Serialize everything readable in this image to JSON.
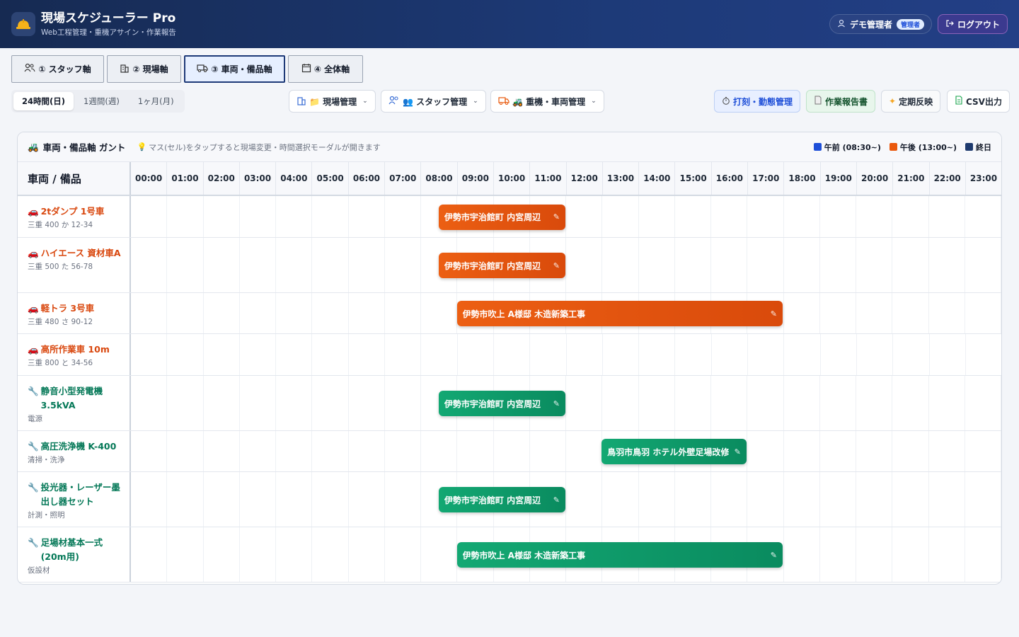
{
  "header": {
    "app_title": "現場スケジューラー Pro",
    "app_subtitle": "Web工程管理・重機アサイン・作業報告",
    "user_name": "デモ管理者",
    "role_badge": "管理者",
    "logout_label": "ログアウト"
  },
  "axis_tabs": [
    {
      "label": "① スタッフ軸",
      "icon": "people-icon",
      "active": false
    },
    {
      "label": "② 現場軸",
      "icon": "building-icon",
      "active": false
    },
    {
      "label": "③ 車両・備品軸",
      "icon": "truck-icon",
      "active": true
    },
    {
      "label": "④ 全体軸",
      "icon": "calendar-icon",
      "active": false
    }
  ],
  "range": [
    {
      "label": "24時間(日)",
      "active": true
    },
    {
      "label": "1週間(週)",
      "active": false
    },
    {
      "label": "1ヶ月(月)",
      "active": false
    }
  ],
  "menus": {
    "site": "📁 現場管理",
    "staff": "👥 スタッフ管理",
    "vehicle": "🚜 重機・車両管理"
  },
  "actions": {
    "punch": "打刻・勤態管理",
    "report": "作業報告書",
    "periodic": "定期反映",
    "csv": "CSV出力"
  },
  "gantt": {
    "title": "車両・備品軸 ガント",
    "hint": "マス(セル)をタップすると現場変更・時間選択モーダルが開きます",
    "legend": [
      {
        "label": "午前 (08:30~)",
        "color": "#1d4ed8"
      },
      {
        "label": "午後 (13:00~)",
        "color": "#ea580c"
      },
      {
        "label": "終日",
        "color": "#1e3a6e"
      }
    ],
    "resource_header": "車両 / 備品",
    "hours": [
      "00:00",
      "01:00",
      "02:00",
      "03:00",
      "04:00",
      "05:00",
      "06:00",
      "07:00",
      "08:00",
      "09:00",
      "10:00",
      "11:00",
      "12:00",
      "13:00",
      "14:00",
      "15:00",
      "16:00",
      "17:00",
      "18:00",
      "19:00",
      "20:00",
      "21:00",
      "22:00",
      "23:00"
    ],
    "rows": [
      {
        "name": "2tダンプ 1号車",
        "sub": "三重 400 か 12-34",
        "kind": "vehicle",
        "bar": {
          "label": "伊勢市宇治館町 内宮周辺",
          "start": 8.5,
          "end": 12.0,
          "color": "orange"
        }
      },
      {
        "name": "ハイエース 資材車A",
        "sub": "三重 500 た 56-78",
        "kind": "vehicle",
        "bar": {
          "label": "伊勢市宇治館町 内宮周辺",
          "start": 8.5,
          "end": 12.0,
          "color": "orange"
        }
      },
      {
        "name": "軽トラ 3号車",
        "sub": "三重 480 さ 90-12",
        "kind": "vehicle",
        "bar": {
          "label": "伊勢市吹上 A様邸 木造新築工事",
          "start": 9.0,
          "end": 18.0,
          "color": "orange"
        }
      },
      {
        "name": "高所作業車 10m",
        "sub": "三重 800 と 34-56",
        "kind": "vehicle",
        "bar": null
      },
      {
        "name": "静音小型発電機 3.5kVA",
        "sub": "電源",
        "kind": "equip",
        "bar": {
          "label": "伊勢市宇治館町 内宮周辺",
          "start": 8.5,
          "end": 12.0,
          "color": "green"
        }
      },
      {
        "name": "高圧洗浄機 K-400",
        "sub": "清掃・洗浄",
        "kind": "equip",
        "bar": {
          "label": "鳥羽市鳥羽 ホテル外壁足場改修",
          "start": 13.0,
          "end": 17.0,
          "color": "green"
        }
      },
      {
        "name": "投光器・レーザー墨出し器セット",
        "sub": "計測・照明",
        "kind": "equip",
        "bar": {
          "label": "伊勢市宇治館町 内宮周辺",
          "start": 8.5,
          "end": 12.0,
          "color": "green"
        }
      },
      {
        "name": "足場材基本一式(20m用)",
        "sub": "仮設材",
        "kind": "equip",
        "bar": {
          "label": "伊勢市吹上 A様邸 木造新築工事",
          "start": 9.0,
          "end": 18.0,
          "color": "green"
        }
      }
    ]
  }
}
